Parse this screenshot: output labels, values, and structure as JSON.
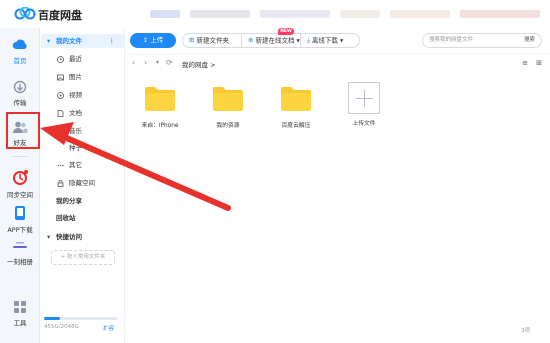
{
  "app": {
    "title": "百度网盘"
  },
  "rail": {
    "items": [
      {
        "label": "首页",
        "icon": "home-cloud-icon",
        "active": true
      },
      {
        "label": "传输",
        "icon": "transfer-icon",
        "active": false
      },
      {
        "label": "好友",
        "icon": "friends-icon",
        "active": false
      },
      {
        "label": "同步空间",
        "icon": "sync-space-icon",
        "active": false
      },
      {
        "label": "APP下载",
        "icon": "app-download-icon",
        "active": false
      },
      {
        "label": "一刻相册",
        "icon": "photo-album-icon",
        "active": false
      },
      {
        "label": "工具",
        "icon": "tools-icon",
        "active": false
      }
    ]
  },
  "sidebar": {
    "my_files": "我的文件",
    "more": "⋮",
    "recent": "最近",
    "pictures": "图片",
    "videos": "视频",
    "documents": "文档",
    "music": "音乐",
    "torrents": "种子",
    "others": "其它",
    "hidden_space": "隐藏空间",
    "my_share": "我的分享",
    "recycle_bin": "回收站",
    "quick_access": "快捷访问",
    "quick_placeholder": "+ 拖入常用文件夹",
    "storage": "455G/2048G",
    "storage_fraction": 0.22,
    "expand": "扩容"
  },
  "toolbar": {
    "upload": "上传",
    "new_folder": "新建文件夹",
    "new_online_doc": "新建在线文档",
    "new_badge": "NEW",
    "offline_download": "离线下载",
    "search_placeholder": "搜索我的网盘文件",
    "search_button": "搜索"
  },
  "nav": {
    "back": "‹",
    "forward": "›",
    "dropdown": "▾",
    "refresh": "⟳",
    "breadcrumb": "我的网盘 >",
    "sort_icon": "≡",
    "grid_icon": "⊞"
  },
  "files": [
    {
      "name": "来自：iPhone",
      "type": "folder"
    },
    {
      "name": "我的资源",
      "type": "folder"
    },
    {
      "name": "百度云解压",
      "type": "folder"
    },
    {
      "name": "上传文件",
      "type": "upload"
    }
  ],
  "status": {
    "count": "3项"
  },
  "colors": {
    "accent": "#1e88f5",
    "folder": "#f9c833",
    "annotation": "#e8302c"
  }
}
